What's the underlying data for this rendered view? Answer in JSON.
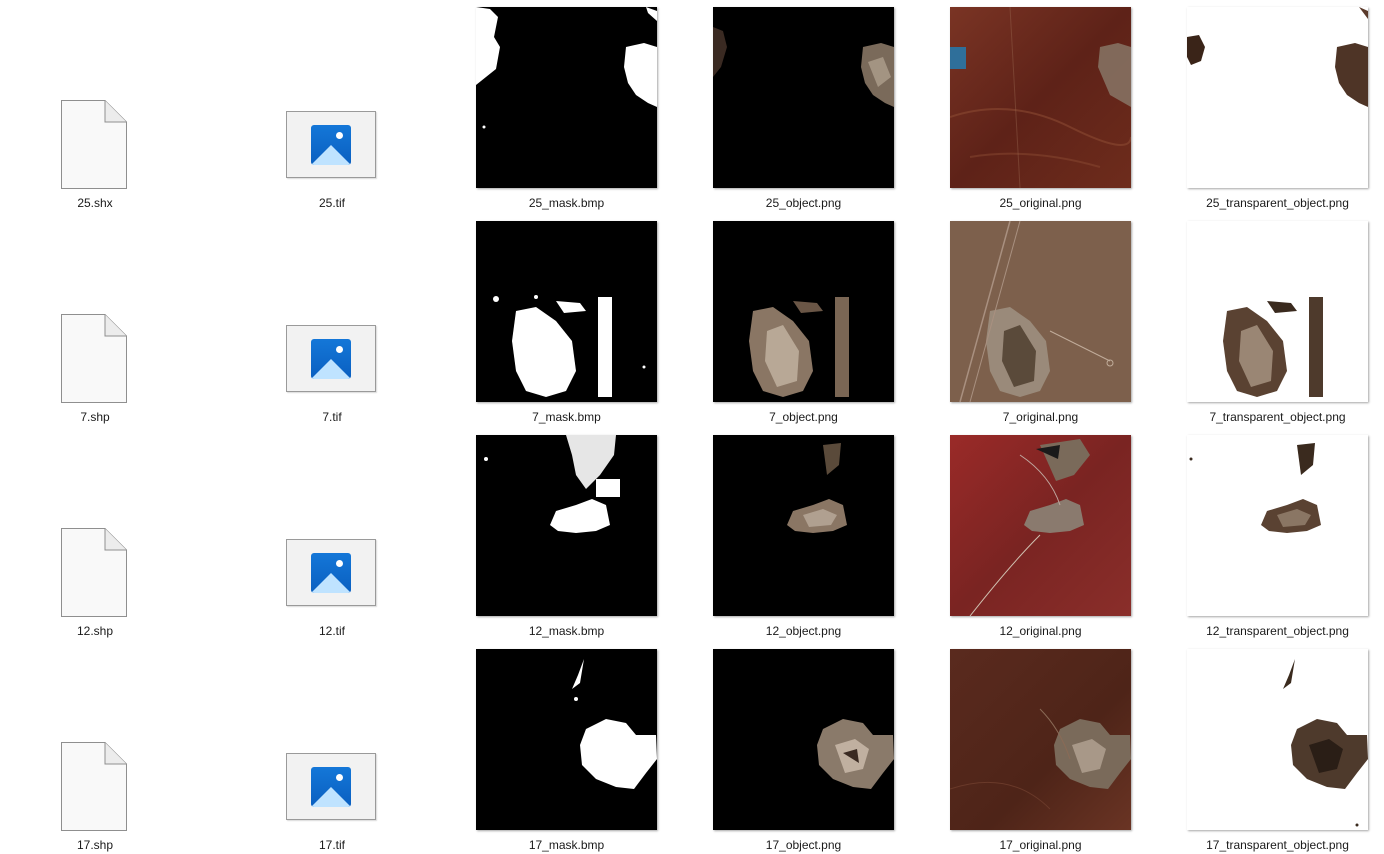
{
  "rows": [
    {
      "files": [
        {
          "name": "25.shx",
          "icon": "document-icon"
        },
        {
          "name": "25.tif",
          "icon": "photo-icon"
        },
        {
          "name": "25_mask.bmp",
          "icon": "mask-thumbnail"
        },
        {
          "name": "25_object.png",
          "icon": "object-thumbnail"
        },
        {
          "name": "25_original.png",
          "icon": "satellite-thumbnail"
        },
        {
          "name": "25_transparent_object.png",
          "icon": "transparent-thumbnail"
        }
      ]
    },
    {
      "files": [
        {
          "name": "7.shp",
          "icon": "document-icon"
        },
        {
          "name": "7.tif",
          "icon": "photo-icon"
        },
        {
          "name": "7_mask.bmp",
          "icon": "mask-thumbnail"
        },
        {
          "name": "7_object.png",
          "icon": "object-thumbnail"
        },
        {
          "name": "7_original.png",
          "icon": "satellite-thumbnail"
        },
        {
          "name": "7_transparent_object.png",
          "icon": "transparent-thumbnail"
        }
      ]
    },
    {
      "files": [
        {
          "name": "12.shp",
          "icon": "document-icon"
        },
        {
          "name": "12.tif",
          "icon": "photo-icon"
        },
        {
          "name": "12_mask.bmp",
          "icon": "mask-thumbnail"
        },
        {
          "name": "12_object.png",
          "icon": "object-thumbnail"
        },
        {
          "name": "12_original.png",
          "icon": "satellite-thumbnail"
        },
        {
          "name": "12_transparent_object.png",
          "icon": "transparent-thumbnail"
        }
      ]
    },
    {
      "files": [
        {
          "name": "17.shp",
          "icon": "document-icon"
        },
        {
          "name": "17.tif",
          "icon": "photo-icon"
        },
        {
          "name": "17_mask.bmp",
          "icon": "mask-thumbnail"
        },
        {
          "name": "17_object.png",
          "icon": "object-thumbnail"
        },
        {
          "name": "17_original.png",
          "icon": "satellite-thumbnail"
        },
        {
          "name": "17_transparent_object.png",
          "icon": "transparent-thumbnail"
        }
      ]
    }
  ],
  "colors": {
    "mask_bg": "#000000",
    "mask_fg": "#ffffff",
    "object_color": "#8a7664",
    "transparent_obj_color": "#4e3a2c",
    "original_25": "#6e2a1e",
    "original_7": "#7a5e4a",
    "original_12": "#8a2a28",
    "original_17": "#5a2a1e",
    "photo_blue": "#0a6fd4"
  }
}
